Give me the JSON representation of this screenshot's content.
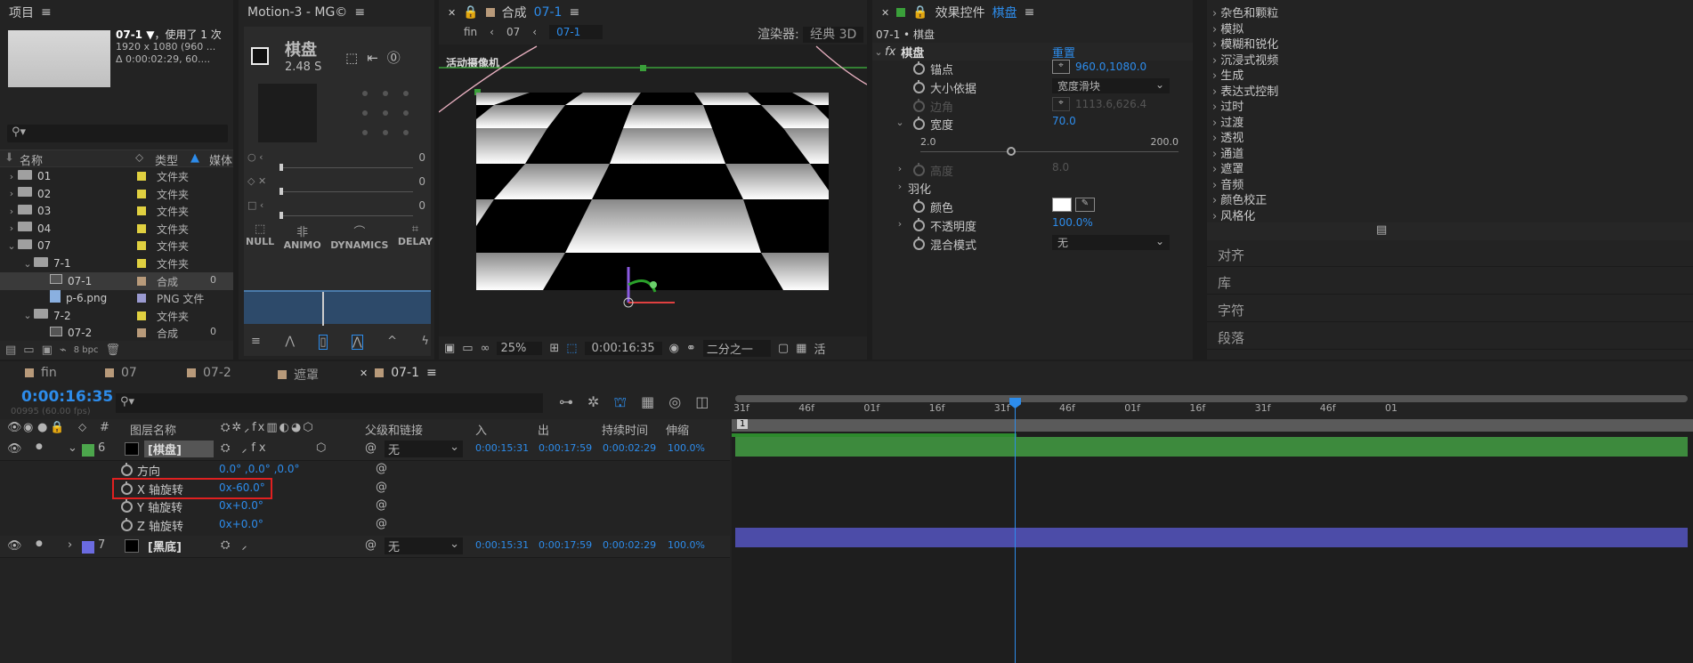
{
  "project": {
    "title": "项目",
    "comp_name": "07-1 ▼",
    "usage": "，使用了 1 次",
    "dims": "1920 x 1080 (960 ...",
    "duration": "Δ 0:00:02:29, 60....",
    "search_placeholder": "",
    "columns": {
      "name": "名称",
      "type": "类型",
      "media": "媒体"
    },
    "items": [
      {
        "chev": "›",
        "indent": 0,
        "kind": "folder",
        "name": "01",
        "color": "#e0d040",
        "type": "文件夹",
        "extra": ""
      },
      {
        "chev": "›",
        "indent": 0,
        "kind": "folder",
        "name": "02",
        "color": "#e0d040",
        "type": "文件夹",
        "extra": ""
      },
      {
        "chev": "›",
        "indent": 0,
        "kind": "folder",
        "name": "03",
        "color": "#e0d040",
        "type": "文件夹",
        "extra": ""
      },
      {
        "chev": "›",
        "indent": 0,
        "kind": "folder",
        "name": "04",
        "color": "#e0d040",
        "type": "文件夹",
        "extra": ""
      },
      {
        "chev": "⌄",
        "indent": 0,
        "kind": "folder",
        "name": "07",
        "color": "#e0d040",
        "type": "文件夹",
        "extra": ""
      },
      {
        "chev": "⌄",
        "indent": 1,
        "kind": "folder",
        "name": "7-1",
        "color": "#e0d040",
        "type": "文件夹",
        "extra": ""
      },
      {
        "chev": "",
        "indent": 2,
        "kind": "comp",
        "name": "07-1",
        "color": "#b89a7a",
        "type": "合成",
        "extra": "0",
        "selected": true
      },
      {
        "chev": "",
        "indent": 2,
        "kind": "png",
        "name": "p-6.png",
        "color": "#9a9ad0",
        "type": "PNG 文件",
        "extra": ""
      },
      {
        "chev": "⌄",
        "indent": 1,
        "kind": "folder",
        "name": "7-2",
        "color": "#e0d040",
        "type": "文件夹",
        "extra": ""
      },
      {
        "chev": "",
        "indent": 2,
        "kind": "comp",
        "name": "07-2",
        "color": "#b89a7a",
        "type": "合成",
        "extra": "0"
      }
    ],
    "bpc": "8 bpc"
  },
  "motion": {
    "title": "Motion-3 - MG©",
    "name": "棋盘",
    "time": "2.48 S",
    "sliders": [
      "0",
      "0",
      "0"
    ],
    "tools": [
      "NULL",
      "ANIMO",
      "DYNAMICS",
      "DELAY"
    ]
  },
  "comp_viewer": {
    "tab_prefix": "合成",
    "tab_name": "07-1",
    "crumbs": [
      "fin",
      "07",
      "07-1"
    ],
    "renderer_label": "渲染器:",
    "renderer_value": "经典 3D",
    "camera_label": "活动摄像机",
    "zoom": "25%",
    "timecode": "0:00:16:35",
    "resolution": "二分之一",
    "extra_label": "活"
  },
  "effects": {
    "tab_prefix": "效果控件",
    "tab_name": "棋盘",
    "layer_path": "07-1 • 棋盘",
    "fx_label": "fx",
    "effect_name": "棋盘",
    "reset": "重置",
    "props": [
      {
        "label": "锚点",
        "value": "960.0,1080.0",
        "kind": "point"
      },
      {
        "label": "大小依据",
        "value": "宽度滑块",
        "kind": "dropdown"
      },
      {
        "label": "边角",
        "value": "1113.6,626.4",
        "kind": "point-dim"
      },
      {
        "label": "宽度",
        "value": "70.0",
        "kind": "number"
      },
      {
        "label": "高度",
        "value": "8.0",
        "kind": "number-dim"
      },
      {
        "label": "羽化",
        "value": "",
        "kind": "group"
      },
      {
        "label": "颜色",
        "value": "",
        "kind": "color"
      },
      {
        "label": "不透明度",
        "value": "100.0%",
        "kind": "number"
      },
      {
        "label": "混合模式",
        "value": "无",
        "kind": "dropdown"
      }
    ],
    "slider_min": "2.0",
    "slider_max": "200.0"
  },
  "effects_list": {
    "items": [
      "杂色和颗粒",
      "模拟",
      "模糊和锐化",
      "沉浸式视频",
      "生成",
      "表达式控制",
      "过时",
      "过渡",
      "透视",
      "通道",
      "遮罩",
      "音频",
      "颜色校正",
      "风格化"
    ],
    "panels": [
      "对齐",
      "库",
      "字符",
      "段落"
    ]
  },
  "timeline": {
    "tabs": [
      {
        "name": "fin",
        "active": false
      },
      {
        "name": "07",
        "active": false
      },
      {
        "name": "07-2",
        "active": false
      },
      {
        "name": "遮罩",
        "active": false
      },
      {
        "name": "07-1",
        "active": true
      }
    ],
    "timecode": "0:00:16:35",
    "frames": "00995 (60.00 fps)",
    "columns": {
      "num": "#",
      "name": "图层名称",
      "parent": "父级和链接",
      "in": "入",
      "out": "出",
      "dur": "持续时间",
      "stretch": "伸缩"
    },
    "ruler": [
      "31f",
      "46f",
      "01f",
      "16f",
      "31f",
      "46f",
      "01f",
      "16f",
      "31f",
      "46f",
      "01"
    ],
    "layers": [
      {
        "num": "6",
        "name": "[棋盘]",
        "color": "#4ca64c",
        "parent": "无",
        "in": "0:00:15:31",
        "out": "0:00:17:59",
        "dur": "0:00:02:29",
        "stretch": "100.0%"
      },
      {
        "num": "7",
        "name": "[黑底]",
        "color": "#6b6be0",
        "parent": "无",
        "in": "0:00:15:31",
        "out": "0:00:17:59",
        "dur": "0:00:02:29",
        "stretch": "100.0%"
      }
    ],
    "props": [
      {
        "label": "方向",
        "value": "0.0° ,0.0° ,0.0°"
      },
      {
        "label": "X 轴旋转",
        "value": "0x-60.0°",
        "highlight": true
      },
      {
        "label": "Y 轴旋转",
        "value": "0x+0.0°"
      },
      {
        "label": "Z 轴旋转",
        "value": "0x+0.0°"
      }
    ]
  }
}
